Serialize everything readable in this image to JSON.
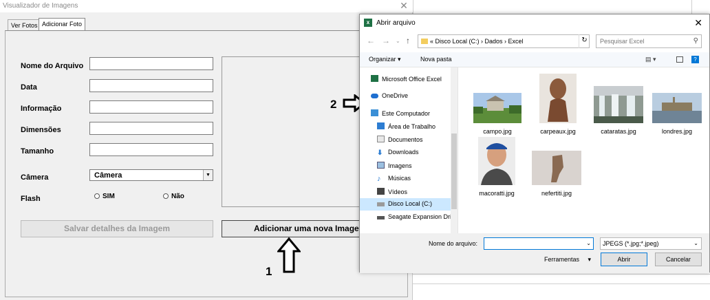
{
  "userform": {
    "title": "Visualizador de Imagens",
    "close_icon": "close-icon",
    "tabs": [
      {
        "label": "Ver Fotos"
      },
      {
        "label": "Adicionar Foto"
      }
    ],
    "fields": {
      "nome_arquivo": "Nome do Arquivo",
      "data": "Data",
      "informacao": "Informação",
      "dimensoes": "Dimensões",
      "tamanho": "Tamanho",
      "camera": "Câmera",
      "flash": "Flash"
    },
    "camera_value": "Câmera",
    "radio_sim": "SIM",
    "radio_nao": "Não",
    "save_button": "Salvar detalhes da Imagem",
    "add_button": "Adicionar uma nova Imagem"
  },
  "annotations": {
    "one": "1",
    "two": "2"
  },
  "dialog": {
    "title": "Abrir arquivo",
    "breadcrumb": "«  Disco Local (C:)  ›  Dados  ›  Excel",
    "search_placeholder": "Pesquisar Excel",
    "toolbar": {
      "organize": "Organizar ▾",
      "new_folder": "Nova pasta"
    },
    "nav_items": [
      {
        "label": "Microsoft Office Excel",
        "icon": "excel-icon"
      },
      {
        "label": "OneDrive",
        "icon": "cloud-icon"
      },
      {
        "label": "Este Computador",
        "icon": "computer-icon"
      },
      {
        "label": "Área de Trabalho",
        "icon": "desktop-icon"
      },
      {
        "label": "Documentos",
        "icon": "document-icon"
      },
      {
        "label": "Downloads",
        "icon": "download-icon"
      },
      {
        "label": "Imagens",
        "icon": "image-icon"
      },
      {
        "label": "Músicas",
        "icon": "music-icon"
      },
      {
        "label": "Vídeos",
        "icon": "video-icon"
      },
      {
        "label": "Disco Local (C:)",
        "icon": "drive-icon"
      },
      {
        "label": "Seagate Expansion Drive",
        "icon": "usb-drive-icon"
      }
    ],
    "files": [
      {
        "name": "campo.jpg"
      },
      {
        "name": "carpeaux.jpg"
      },
      {
        "name": "cataratas.jpg"
      },
      {
        "name": "londres.jpg"
      },
      {
        "name": "macoratti.jpg"
      },
      {
        "name": "nefertiti.jpg"
      }
    ],
    "filename_label": "Nome do arquivo:",
    "filename_value": "",
    "filetype": "JPEGS (*.jpg;*.jpeg)",
    "tools": "Ferramentas",
    "open_button": "Abrir",
    "cancel_button": "Cancelar"
  },
  "colors": {
    "accent": "#0078d7",
    "excel_green": "#1e7145",
    "selected_nav": "#cce8ff"
  }
}
